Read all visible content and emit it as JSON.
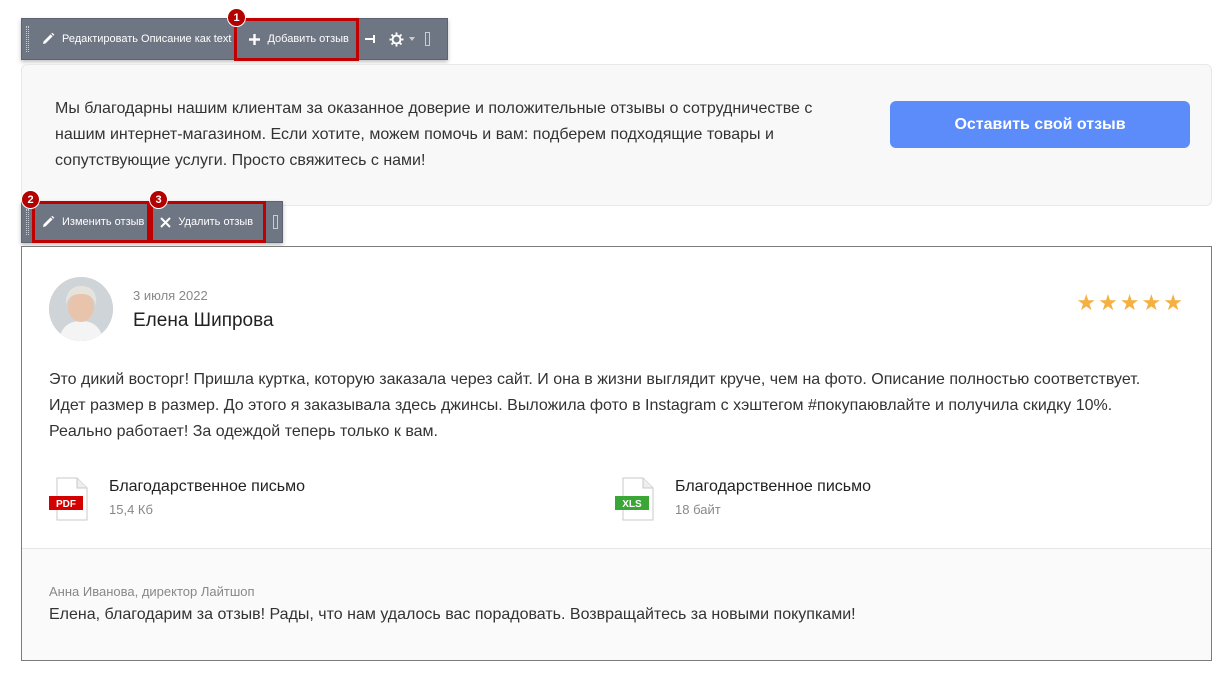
{
  "toolbar_top": {
    "edit_label": "Редактировать Описание как text",
    "add_label": "Добавить отзыв",
    "badge": "1"
  },
  "info": {
    "text": "Мы благодарны нашим клиентам за оказанное доверие и положительные отзывы о сотрудничестве с нашим интернет-магазином. Если хотите, можем помочь и вам: подберем подходящие товары и сопутствующие услуги. Просто свяжитесь с нами!",
    "button_label": "Оставить свой отзыв"
  },
  "toolbar_review": {
    "edit_label": "Изменить отзыв",
    "delete_label": "Удалить отзыв",
    "badge_edit": "2",
    "badge_delete": "3"
  },
  "review": {
    "date": "3 июля 2022",
    "name": "Елена Шипрова",
    "rating": 5,
    "text": "Это дикий восторг! Пришла куртка, которую заказала через сайт. И она в жизни выглядит круче, чем на фото. Описание полностью соответствует. Идет размер в размер. До этого я заказывала здесь джинсы. Выложила фото в Instagram с хэштегом #покупаювлайте и получила скидку 10%. Реально работает! За одеждой теперь только к вам.",
    "files": [
      {
        "name": "Благодарственное письмо",
        "size": "15,4 Кб",
        "type": "PDF",
        "color": "#d40000"
      },
      {
        "name": "Благодарственное письмо",
        "size": "18 байт",
        "type": "XLS",
        "color": "#3aa635"
      }
    ],
    "reply": {
      "author": "Анна Иванова, директор Лайтшоп",
      "text": "Елена, благодарим за отзыв! Рады, что нам удалось вас порадовать. Возвращайтесь за новыми покупками!"
    }
  },
  "colors": {
    "accent": "#5c8cfa",
    "star": "#f5b042",
    "toolbar": "#6e7583",
    "highlight": "#c00000"
  }
}
